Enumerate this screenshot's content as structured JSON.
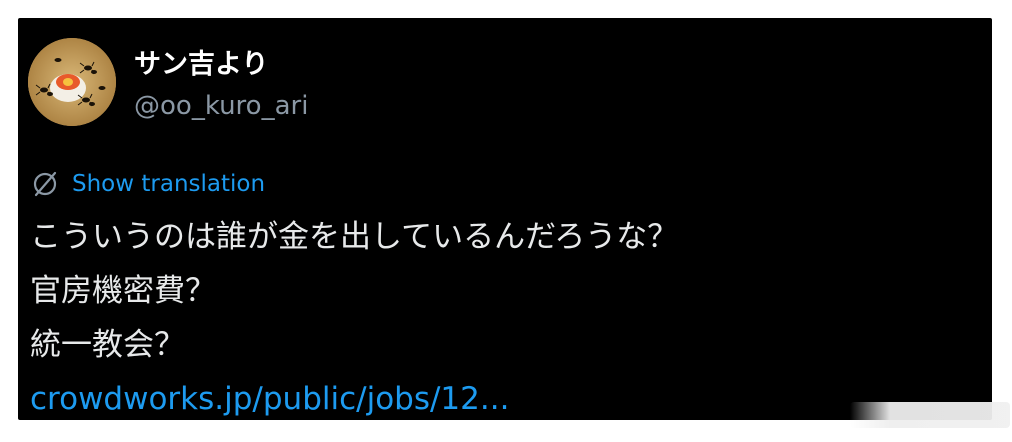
{
  "user": {
    "display_name": "サン吉より",
    "handle": "@oo_kuro_ari"
  },
  "translation": {
    "label": "Show translation",
    "icon": "globe-slash-icon"
  },
  "tweet": {
    "lines": [
      "こういうのは誰が金を出しているんだろうな？",
      "官房機密費？",
      "統一教会？"
    ],
    "link": "crowdworks.jp/public/jobs/12..."
  },
  "colors": {
    "background": "#000000",
    "text": "#e7e9ea",
    "secondary": "#8b98a5",
    "accent": "#1d9bf0"
  }
}
